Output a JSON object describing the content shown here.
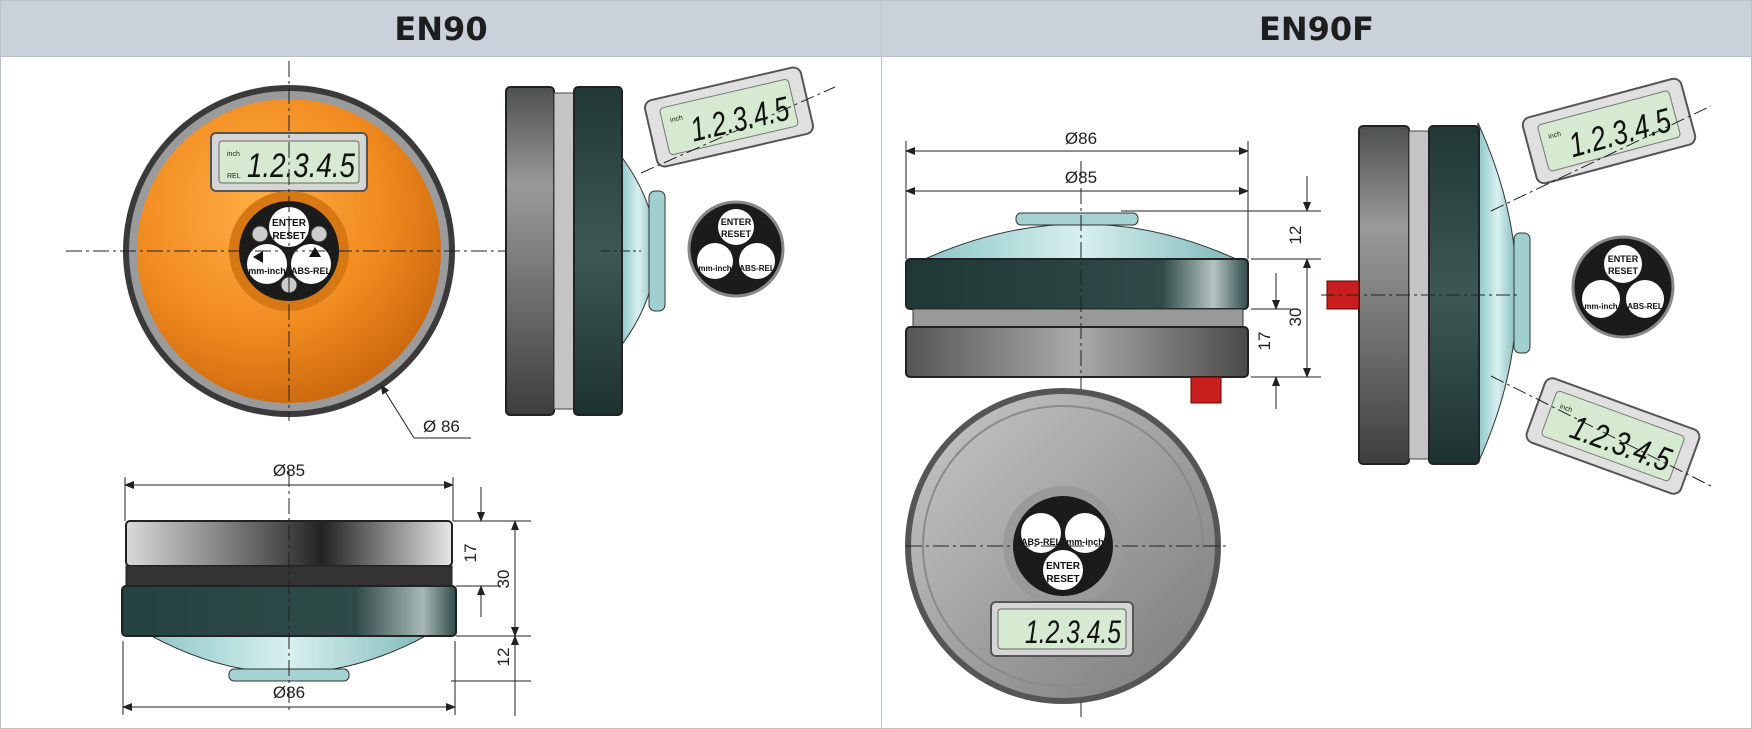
{
  "panels": [
    {
      "title": "EN90",
      "dim_front": "Ø 86",
      "dim_width_top": "Ø85",
      "dim_width_bottom": "Ø86",
      "dim_h_17": "17",
      "dim_h_30": "30",
      "dim_h_12": "12"
    },
    {
      "title": "EN90F",
      "dim_width_top": "Ø86",
      "dim_width_second": "Ø85",
      "dim_h_12": "12",
      "dim_h_30": "30",
      "dim_h_17": "17"
    }
  ],
  "display": {
    "reading": "1.2.3.4.5",
    "unit_top": "inch",
    "unit_bottom": "REL"
  },
  "keypad": {
    "enter": "ENTER",
    "reset": "RESET",
    "mm_inch": "mm-inch",
    "abs_rel": "ABS-REL"
  },
  "colors": {
    "header_bg": "#c9d1da",
    "orange_face": "#f08a1f",
    "lcd_green": "#d5ead0",
    "dark_body": "#2e4744",
    "dome": "#b5dada"
  }
}
